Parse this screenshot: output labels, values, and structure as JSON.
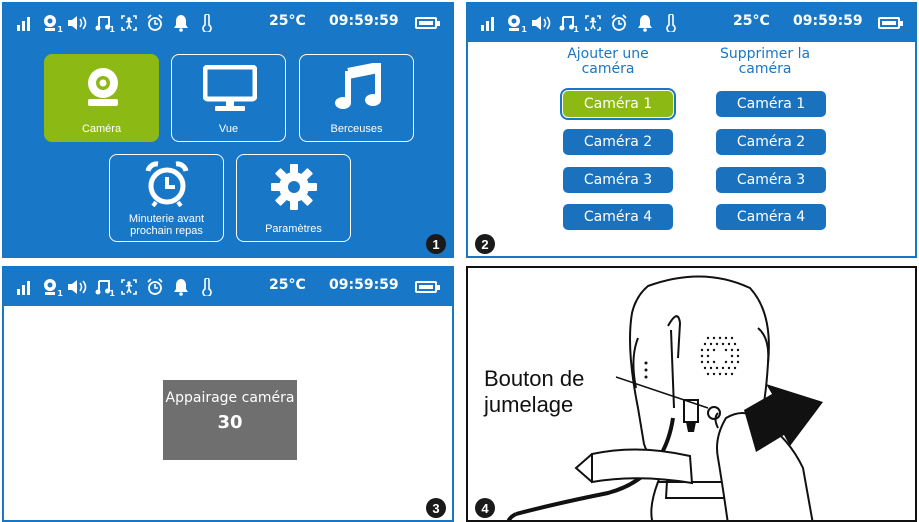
{
  "statusbar": {
    "icons": [
      "signal-icon",
      "camera-icon",
      "volume-icon",
      "music-icon",
      "vox-icon",
      "alarm-icon",
      "bell-icon",
      "thermometer-icon"
    ],
    "camera_sub": "1",
    "music_sub": "1",
    "temperature": "25°C",
    "time": "09:59:59"
  },
  "panel1": {
    "number": "1",
    "tiles": [
      {
        "label": "Caméra",
        "icon": "camera-icon",
        "selected": true
      },
      {
        "label": "Vue",
        "icon": "monitor-icon",
        "selected": false
      },
      {
        "label": "Berceuses",
        "icon": "music-note-icon",
        "selected": false
      },
      {
        "label": "Minuterie avant prochain repas",
        "icon": "alarm-clock-icon",
        "selected": false
      },
      {
        "label": "Paramètres",
        "icon": "gear-icon",
        "selected": false
      }
    ]
  },
  "panel2": {
    "number": "2",
    "add_header": "Ajouter une caméra",
    "remove_header": "Supprimer la caméra",
    "add_buttons": [
      "Caméra 1",
      "Caméra 2",
      "Caméra 3",
      "Caméra 4"
    ],
    "remove_buttons": [
      "Caméra 1",
      "Caméra 2",
      "Caméra 3",
      "Caméra 4"
    ],
    "selected_add_index": 0
  },
  "panel3": {
    "number": "3",
    "title": "Appairage caméra",
    "countdown": "30"
  },
  "panel4": {
    "number": "4",
    "label": "Bouton de jumelage"
  },
  "colors": {
    "screen_blue": "#1877c6",
    "button_blue": "#1a72bf",
    "selected_green": "#8cb913",
    "overlay_gray": "#6f6f6f"
  }
}
